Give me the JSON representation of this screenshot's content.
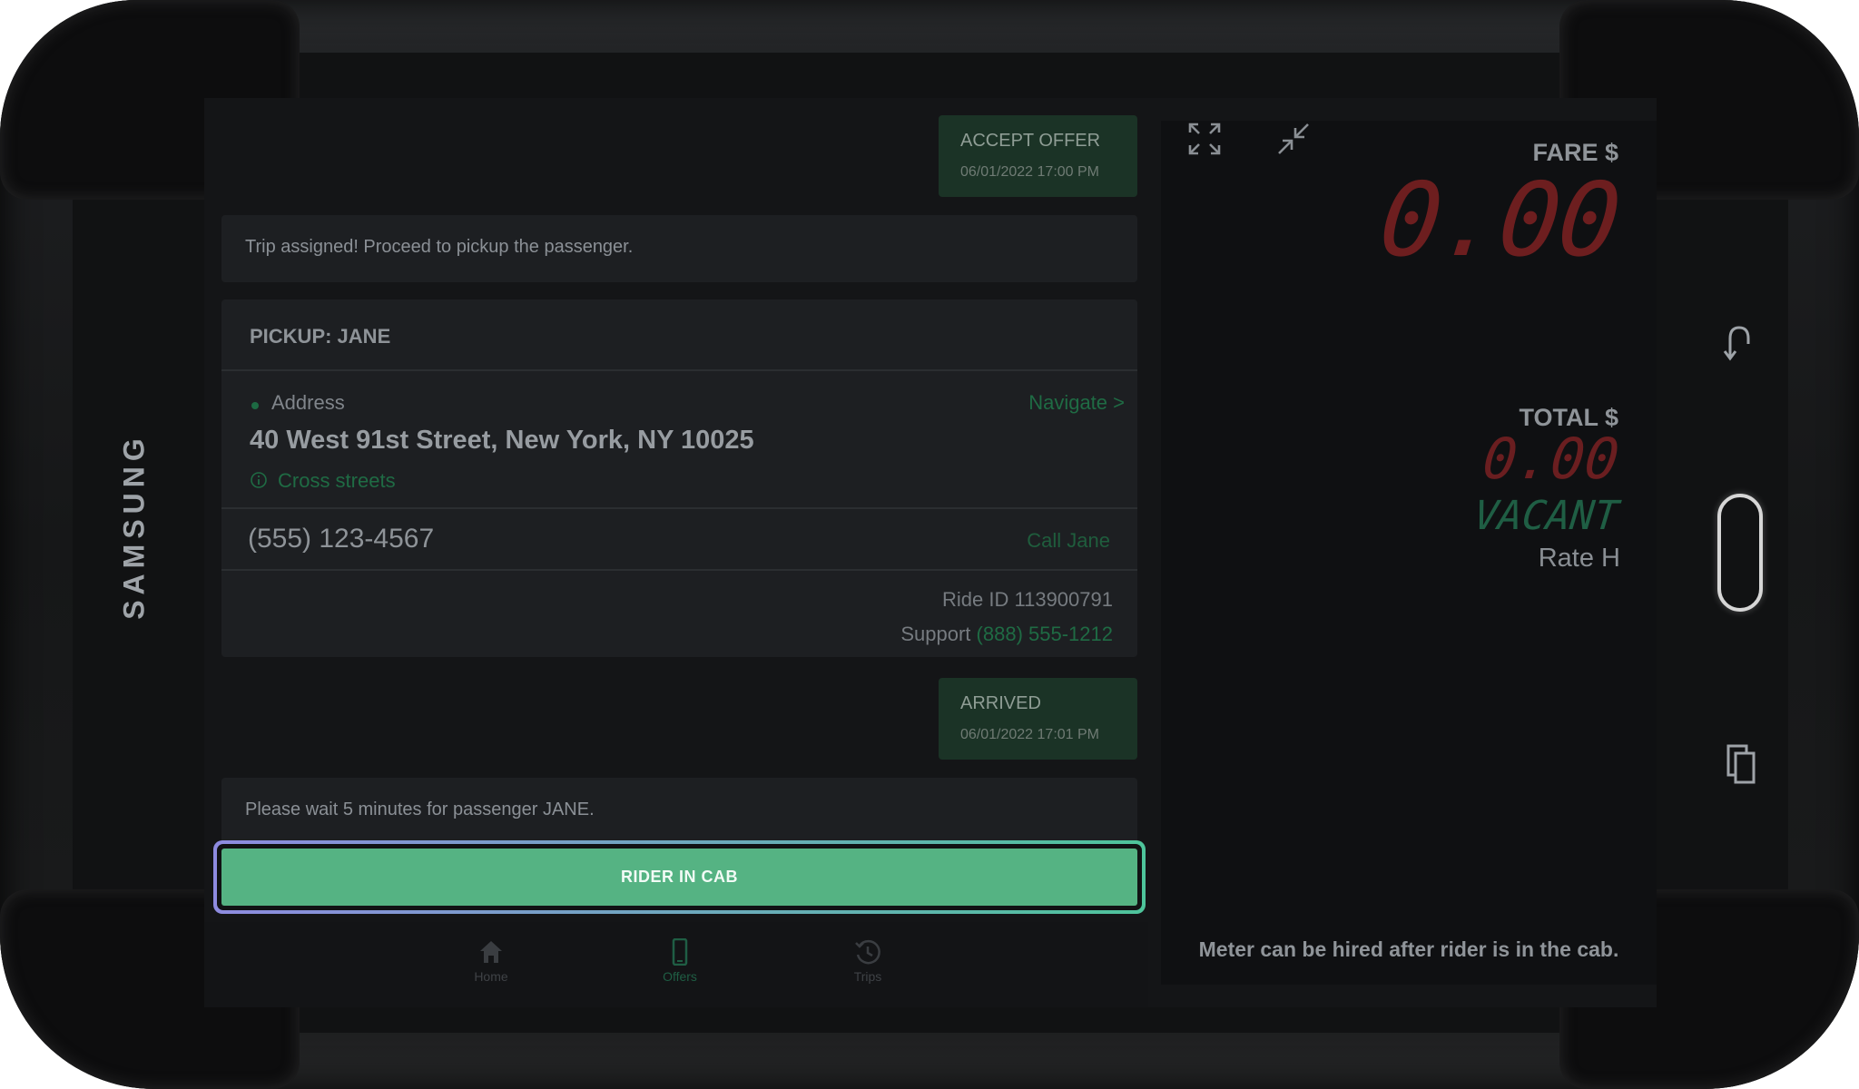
{
  "device": {
    "brand": "SAMSUNG"
  },
  "messages": {
    "accept_offer": {
      "title": "ACCEPT OFFER",
      "timestamp": "06/01/2022 17:00 PM"
    },
    "trip_assigned": "Trip assigned! Proceed to pickup the passenger.",
    "arrived": {
      "title": "ARRIVED",
      "timestamp": "06/01/2022 17:01 PM"
    },
    "wait_notice": "Please wait 5 minutes for passenger JANE."
  },
  "pickup": {
    "header": "PICKUP: JANE",
    "address_label": "Address",
    "navigate_link": "Navigate >",
    "address": "40 West 91st Street, New York, NY 10025",
    "cross_streets_link": "Cross streets",
    "phone": "(555) 123-4567",
    "call_link": "Call Jane",
    "ride_id": "Ride ID 113900791",
    "support_label": "Support",
    "support_phone": "(888) 555-1212"
  },
  "action": {
    "label": "RIDER IN CAB"
  },
  "nav": {
    "home": "Home",
    "offers": "Offers",
    "trips": "Trips",
    "active": "offers"
  },
  "meter": {
    "fare_label": "FARE $",
    "fare_value": "0.00",
    "total_label": "TOTAL $",
    "total_value": "0.00",
    "status": "VACANT",
    "rate": "Rate H",
    "note": "Meter can be hired after rider is in the cab."
  },
  "colors": {
    "accent_green": "#55b383",
    "link_green": "#1f6b44",
    "meter_red": "#6d1e1f",
    "vacant_green": "#1f5e44"
  }
}
